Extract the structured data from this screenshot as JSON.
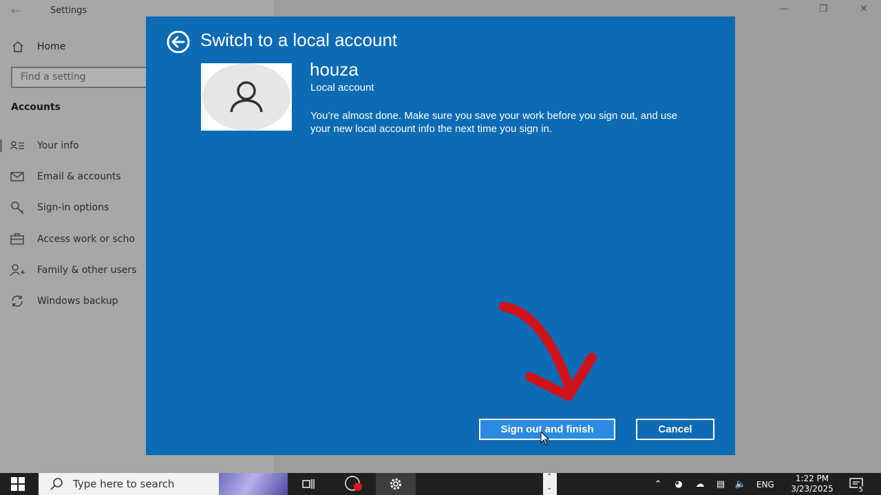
{
  "window": {
    "title": "Settings",
    "back_icon": "arrow-left-icon",
    "controls": [
      "minimize-icon",
      "restore-icon",
      "close-icon"
    ]
  },
  "sidebar": {
    "home_label": "Home",
    "search_placeholder": "Find a setting",
    "section_title": "Accounts",
    "items": [
      {
        "label": "Your info",
        "icon": "person-card-icon"
      },
      {
        "label": "Email & accounts",
        "icon": "mail-icon"
      },
      {
        "label": "Sign-in options",
        "icon": "key-icon"
      },
      {
        "label": "Access work or scho",
        "icon": "briefcase-icon"
      },
      {
        "label": "Family & other users",
        "icon": "add-person-icon"
      },
      {
        "label": "Windows backup",
        "icon": "sync-icon"
      }
    ]
  },
  "dialog": {
    "title": "Switch to a local account",
    "user_name": "houza",
    "account_type": "Local account",
    "message": "You’re almost done. Make sure you save your work before you sign out, and use your new local account info the next time you sign in.",
    "primary_button": "Sign out and finish",
    "cancel_button": "Cancel",
    "background_color": "#0b6bb5"
  },
  "taskbar": {
    "search_placeholder": "Type here to search",
    "language": "ENG",
    "time": "1:22 PM",
    "date": "3/23/2025",
    "notification_count": "5"
  }
}
